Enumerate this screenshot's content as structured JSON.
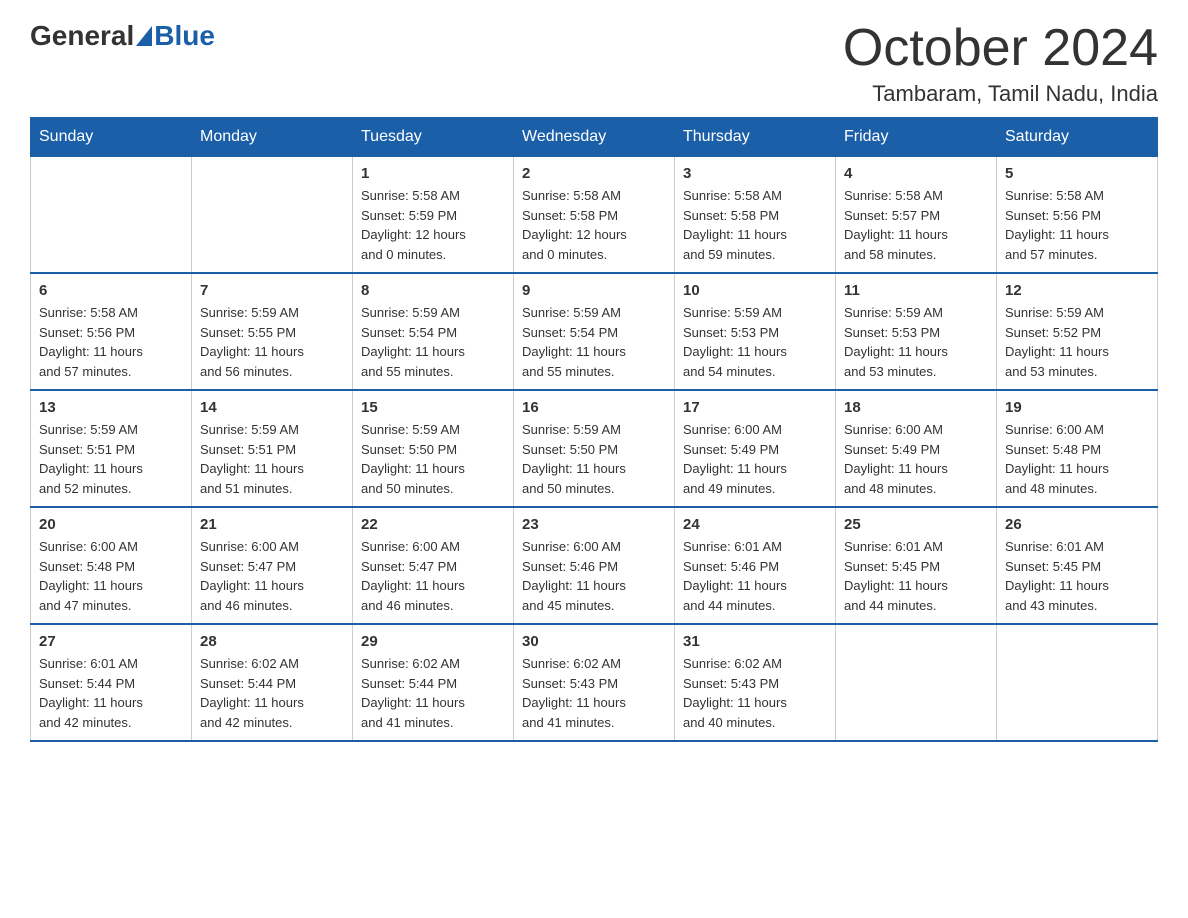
{
  "header": {
    "logo_general": "General",
    "logo_blue": "Blue",
    "month": "October 2024",
    "location": "Tambaram, Tamil Nadu, India"
  },
  "days_of_week": [
    "Sunday",
    "Monday",
    "Tuesday",
    "Wednesday",
    "Thursday",
    "Friday",
    "Saturday"
  ],
  "weeks": [
    [
      {
        "day": "",
        "info": ""
      },
      {
        "day": "",
        "info": ""
      },
      {
        "day": "1",
        "info": "Sunrise: 5:58 AM\nSunset: 5:59 PM\nDaylight: 12 hours\nand 0 minutes."
      },
      {
        "day": "2",
        "info": "Sunrise: 5:58 AM\nSunset: 5:58 PM\nDaylight: 12 hours\nand 0 minutes."
      },
      {
        "day": "3",
        "info": "Sunrise: 5:58 AM\nSunset: 5:58 PM\nDaylight: 11 hours\nand 59 minutes."
      },
      {
        "day": "4",
        "info": "Sunrise: 5:58 AM\nSunset: 5:57 PM\nDaylight: 11 hours\nand 58 minutes."
      },
      {
        "day": "5",
        "info": "Sunrise: 5:58 AM\nSunset: 5:56 PM\nDaylight: 11 hours\nand 57 minutes."
      }
    ],
    [
      {
        "day": "6",
        "info": "Sunrise: 5:58 AM\nSunset: 5:56 PM\nDaylight: 11 hours\nand 57 minutes."
      },
      {
        "day": "7",
        "info": "Sunrise: 5:59 AM\nSunset: 5:55 PM\nDaylight: 11 hours\nand 56 minutes."
      },
      {
        "day": "8",
        "info": "Sunrise: 5:59 AM\nSunset: 5:54 PM\nDaylight: 11 hours\nand 55 minutes."
      },
      {
        "day": "9",
        "info": "Sunrise: 5:59 AM\nSunset: 5:54 PM\nDaylight: 11 hours\nand 55 minutes."
      },
      {
        "day": "10",
        "info": "Sunrise: 5:59 AM\nSunset: 5:53 PM\nDaylight: 11 hours\nand 54 minutes."
      },
      {
        "day": "11",
        "info": "Sunrise: 5:59 AM\nSunset: 5:53 PM\nDaylight: 11 hours\nand 53 minutes."
      },
      {
        "day": "12",
        "info": "Sunrise: 5:59 AM\nSunset: 5:52 PM\nDaylight: 11 hours\nand 53 minutes."
      }
    ],
    [
      {
        "day": "13",
        "info": "Sunrise: 5:59 AM\nSunset: 5:51 PM\nDaylight: 11 hours\nand 52 minutes."
      },
      {
        "day": "14",
        "info": "Sunrise: 5:59 AM\nSunset: 5:51 PM\nDaylight: 11 hours\nand 51 minutes."
      },
      {
        "day": "15",
        "info": "Sunrise: 5:59 AM\nSunset: 5:50 PM\nDaylight: 11 hours\nand 50 minutes."
      },
      {
        "day": "16",
        "info": "Sunrise: 5:59 AM\nSunset: 5:50 PM\nDaylight: 11 hours\nand 50 minutes."
      },
      {
        "day": "17",
        "info": "Sunrise: 6:00 AM\nSunset: 5:49 PM\nDaylight: 11 hours\nand 49 minutes."
      },
      {
        "day": "18",
        "info": "Sunrise: 6:00 AM\nSunset: 5:49 PM\nDaylight: 11 hours\nand 48 minutes."
      },
      {
        "day": "19",
        "info": "Sunrise: 6:00 AM\nSunset: 5:48 PM\nDaylight: 11 hours\nand 48 minutes."
      }
    ],
    [
      {
        "day": "20",
        "info": "Sunrise: 6:00 AM\nSunset: 5:48 PM\nDaylight: 11 hours\nand 47 minutes."
      },
      {
        "day": "21",
        "info": "Sunrise: 6:00 AM\nSunset: 5:47 PM\nDaylight: 11 hours\nand 46 minutes."
      },
      {
        "day": "22",
        "info": "Sunrise: 6:00 AM\nSunset: 5:47 PM\nDaylight: 11 hours\nand 46 minutes."
      },
      {
        "day": "23",
        "info": "Sunrise: 6:00 AM\nSunset: 5:46 PM\nDaylight: 11 hours\nand 45 minutes."
      },
      {
        "day": "24",
        "info": "Sunrise: 6:01 AM\nSunset: 5:46 PM\nDaylight: 11 hours\nand 44 minutes."
      },
      {
        "day": "25",
        "info": "Sunrise: 6:01 AM\nSunset: 5:45 PM\nDaylight: 11 hours\nand 44 minutes."
      },
      {
        "day": "26",
        "info": "Sunrise: 6:01 AM\nSunset: 5:45 PM\nDaylight: 11 hours\nand 43 minutes."
      }
    ],
    [
      {
        "day": "27",
        "info": "Sunrise: 6:01 AM\nSunset: 5:44 PM\nDaylight: 11 hours\nand 42 minutes."
      },
      {
        "day": "28",
        "info": "Sunrise: 6:02 AM\nSunset: 5:44 PM\nDaylight: 11 hours\nand 42 minutes."
      },
      {
        "day": "29",
        "info": "Sunrise: 6:02 AM\nSunset: 5:44 PM\nDaylight: 11 hours\nand 41 minutes."
      },
      {
        "day": "30",
        "info": "Sunrise: 6:02 AM\nSunset: 5:43 PM\nDaylight: 11 hours\nand 41 minutes."
      },
      {
        "day": "31",
        "info": "Sunrise: 6:02 AM\nSunset: 5:43 PM\nDaylight: 11 hours\nand 40 minutes."
      },
      {
        "day": "",
        "info": ""
      },
      {
        "day": "",
        "info": ""
      }
    ]
  ]
}
